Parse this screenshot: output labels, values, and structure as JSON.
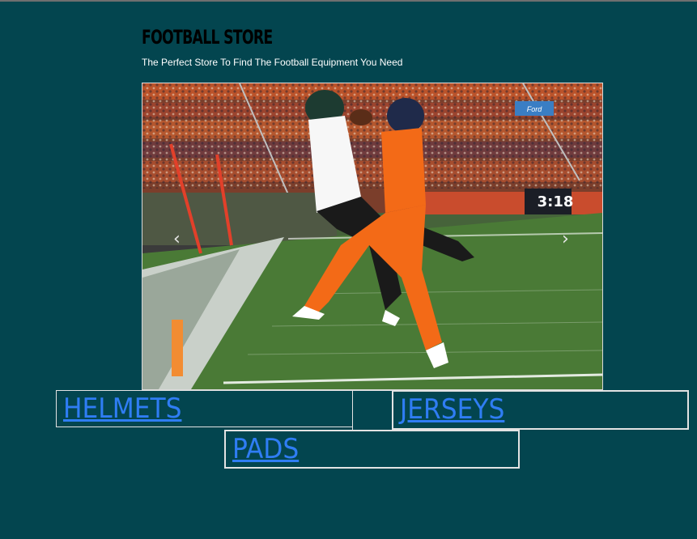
{
  "header": {
    "title": "FOOTBALL STORE",
    "subtitle": "The Perfect Store To Find The Football Equipment You Need"
  },
  "carousel": {
    "prev_icon": "chevron-left-icon",
    "next_icon": "chevron-right-icon",
    "prev_glyph": "‹",
    "next_glyph": "›",
    "scoreboard_time": "3:18",
    "banner_text": "Ford"
  },
  "categories": {
    "helmets": "HELMETS",
    "jerseys": "JERSEYS",
    "pads": "PADS"
  },
  "colors": {
    "background": "#03454f",
    "link": "#2f7df4",
    "player1_jersey": "#f7f7f7",
    "player2_jersey": "#f36a17"
  }
}
